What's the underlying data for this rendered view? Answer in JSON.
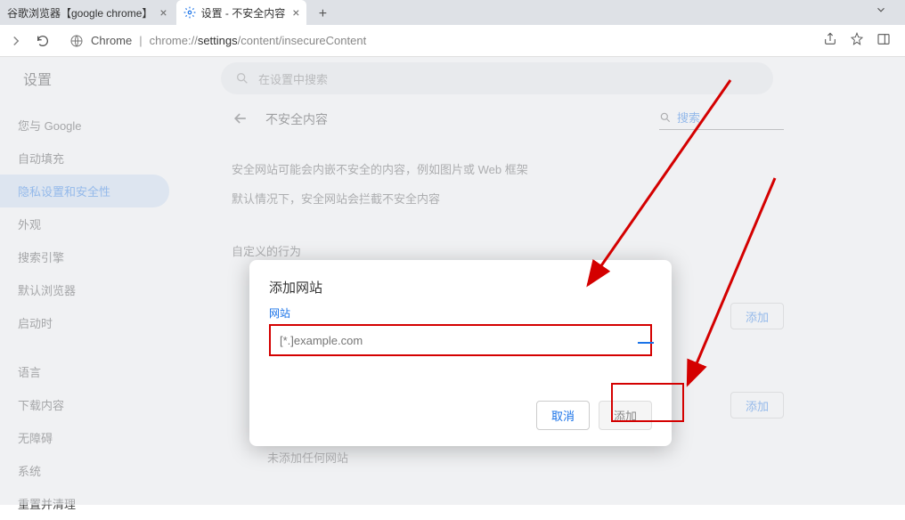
{
  "tabs": [
    {
      "title": "谷歌浏览器【google chrome】",
      "active": false
    },
    {
      "title": "设置 - 不安全内容",
      "active": true
    }
  ],
  "url": {
    "prefix": "Chrome",
    "path_dim": "chrome://",
    "path_main": "settings",
    "path_sub": "/content/insecureContent"
  },
  "header": {
    "title": "设置",
    "search_placeholder": "在设置中搜索"
  },
  "sidebar": {
    "items": [
      "您与 Google",
      "自动填充",
      "隐私设置和安全性",
      "外观",
      "搜索引擎",
      "默认浏览器",
      "启动时"
    ],
    "items2": [
      "语言",
      "下载内容",
      "无障碍",
      "系统",
      "重置并清理"
    ],
    "active_index": 2
  },
  "content": {
    "page_title": "不安全内容",
    "search_label": "搜索",
    "desc1": "安全网站可能会内嵌不安全的内容，例如图片或 Web 框架",
    "desc2": "默认情况下，安全网站会拦截不安全内容",
    "section_label": "自定义的行为",
    "add_button": "添加",
    "no_added": "未添加任何网站"
  },
  "dialog": {
    "title": "添加网站",
    "label": "网站",
    "placeholder": "[*.]example.com",
    "cancel": "取消",
    "confirm": "添加"
  }
}
